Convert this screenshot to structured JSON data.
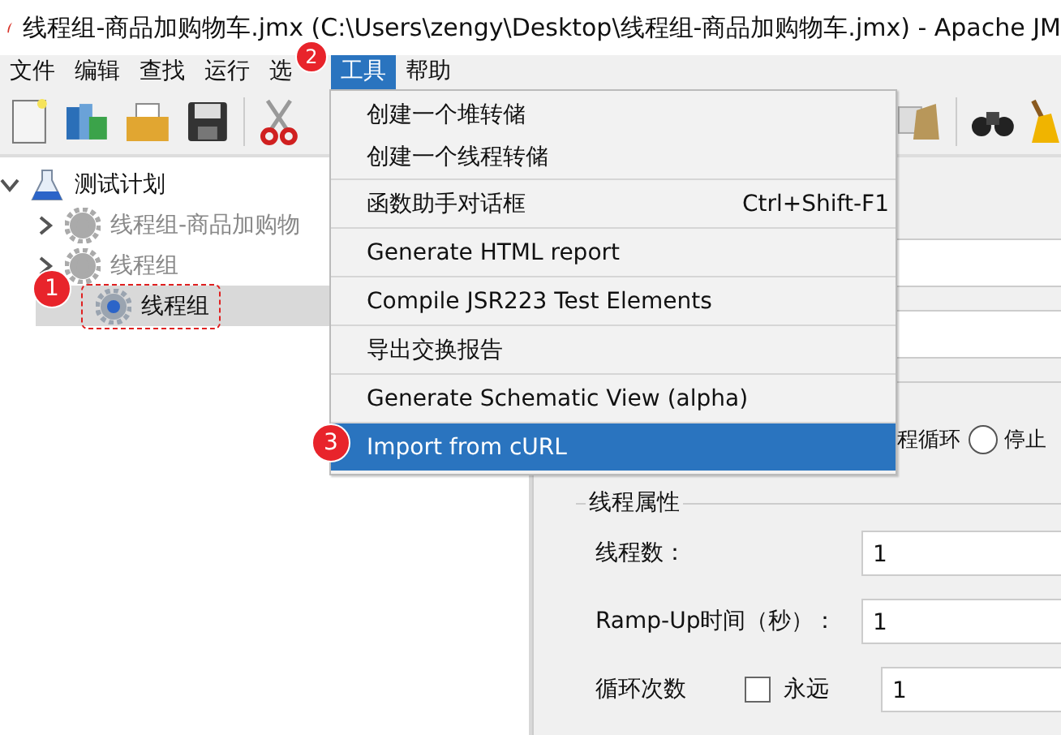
{
  "window": {
    "title": "线程组-商品加购物车.jmx (C:\\Users\\zengy\\Desktop\\线程组-商品加购物车.jmx) - Apache JM"
  },
  "menu_bar": [
    {
      "label": "文件",
      "selected": false
    },
    {
      "label": "编辑",
      "selected": false
    },
    {
      "label": "查找",
      "selected": false
    },
    {
      "label": "运行",
      "selected": false
    },
    {
      "label": "选",
      "selected": false
    },
    {
      "label": "工具",
      "selected": true
    },
    {
      "label": "帮助",
      "selected": false
    }
  ],
  "tools_menu": {
    "items": [
      {
        "label": "创建一个堆转储",
        "selected": false,
        "kind": "plain"
      },
      {
        "label": "创建一个线程转储",
        "selected": false,
        "kind": "plain"
      },
      {
        "label": "函数助手对话框",
        "shortcut": "Ctrl+Shift-F1",
        "selected": false,
        "kind": "separated"
      },
      {
        "label": "Generate HTML report",
        "selected": false,
        "kind": "separated"
      },
      {
        "label": "Compile JSR223 Test Elements",
        "selected": false,
        "kind": "separated"
      },
      {
        "label": "导出交换报告",
        "selected": false,
        "kind": "separated"
      },
      {
        "label": "Generate Schematic View (alpha)",
        "selected": false,
        "kind": "separated"
      },
      {
        "label": "Import from cURL",
        "selected": true,
        "kind": "separated"
      }
    ]
  },
  "tree": {
    "items": [
      {
        "label": "测试计划",
        "kind": "plan",
        "expanded": true,
        "selected": false,
        "disabled": false,
        "children": [
          {
            "label": "线程组-商品加购物",
            "kind": "group",
            "expanded": false,
            "selected": false,
            "disabled": true
          },
          {
            "label": "线程组",
            "kind": "group",
            "expanded": false,
            "selected": false,
            "disabled": true
          },
          {
            "label": "线程组",
            "kind": "leaf",
            "selected": true,
            "disabled": false
          }
        ]
      }
    ]
  },
  "annotations": [
    {
      "number": "1"
    },
    {
      "number": "2"
    },
    {
      "number": "3"
    }
  ],
  "loop_actions": [
    {
      "label": "程循环",
      "kind": "fragment"
    },
    {
      "label": "停止",
      "kind": "radio",
      "selected": false
    }
  ],
  "thread_properties": {
    "title": "线程属性",
    "rows": [
      {
        "label": "线程数：",
        "value": "1",
        "kind": "field"
      },
      {
        "label": "Ramp-Up时间（秒）：",
        "value": "1",
        "kind": "field"
      },
      {
        "label": "循环次数",
        "value": "1",
        "kind": "loop",
        "forever": {
          "label": "永远",
          "checked": false
        }
      }
    ]
  }
}
